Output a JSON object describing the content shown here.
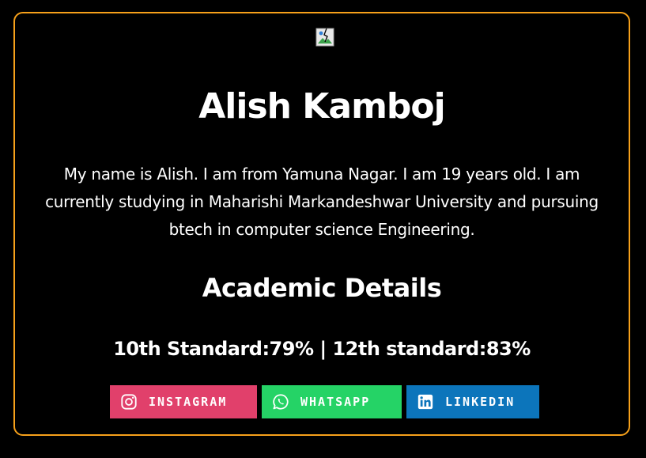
{
  "profile": {
    "image_alt": "",
    "name": "Alish Kamboj",
    "bio": "My name is Alish. I am from Yamuna Nagar. I am 19 years old. I am currently studying in Maharishi Markandeshwar University and pursuing btech in computer science Engineering."
  },
  "academics": {
    "title": "Academic Details",
    "scores": "10th Standard:79% | 12th standard:83%"
  },
  "social": [
    {
      "label": "INSTAGRAM",
      "icon": "instagram-icon",
      "color": "#e1406b"
    },
    {
      "label": "WHATSAPP",
      "icon": "whatsapp-icon",
      "color": "#25d366"
    },
    {
      "label": "LINKEDIN",
      "icon": "linkedin-icon",
      "color": "#0c75bb"
    }
  ],
  "theme": {
    "background": "#000000",
    "border_accent": "#f6a01a",
    "text": "#ffffff"
  }
}
